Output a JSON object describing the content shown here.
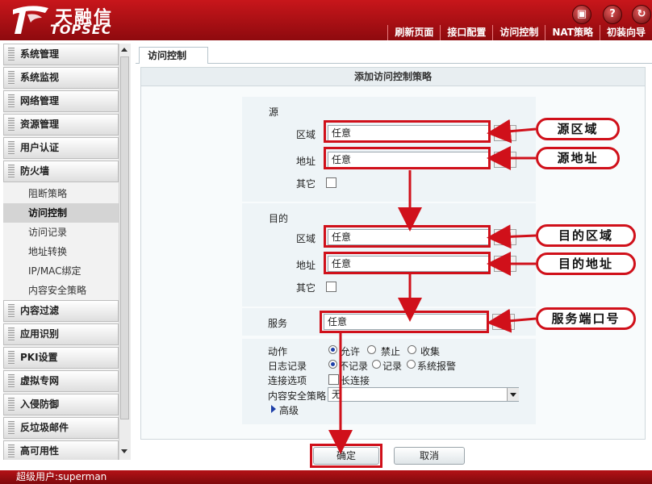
{
  "header": {
    "brand_cn": "天融信",
    "brand_en": "TOPSEC",
    "icons": [
      "save-icon",
      "help-icon",
      "logout-icon"
    ],
    "icon_glyphs": [
      "▣",
      "?",
      "↻"
    ],
    "nav": [
      "刷新页面",
      "接口配置",
      "访问控制",
      "NAT策略",
      "初装向导"
    ]
  },
  "sidebar": {
    "items_top": [
      "系统管理",
      "系统监视",
      "网络管理",
      "资源管理",
      "用户认证",
      "防火墙"
    ],
    "firewall_sub": [
      "阻断策略",
      "访问控制",
      "访问记录",
      "地址转换",
      "IP/MAC绑定",
      "内容安全策略"
    ],
    "active_sub": "访问控制",
    "items_bottom": [
      "内容过滤",
      "应用识别",
      "PKI设置",
      "虚拟专网",
      "入侵防御",
      "反垃圾邮件",
      "高可用性"
    ]
  },
  "tab": {
    "label": "访问控制"
  },
  "panel": {
    "title": "添加访问控制策略"
  },
  "source": {
    "heading": "源",
    "zone_label": "区域",
    "zone_value": "任意",
    "addr_label": "地址",
    "addr_value": "任意",
    "other_label": "其它"
  },
  "dest": {
    "heading": "目的",
    "zone_label": "区域",
    "zone_value": "任意",
    "addr_label": "地址",
    "addr_value": "任意",
    "other_label": "其它"
  },
  "service": {
    "label": "服务",
    "value": "任意"
  },
  "options": {
    "action_label": "动作",
    "action_options": [
      "允许",
      "禁止",
      "收集"
    ],
    "log_label": "日志记录",
    "log_options": [
      "不记录",
      "记录",
      "系统报警"
    ],
    "conn_label": "连接选项",
    "conn_option": "长连接",
    "content_label": "内容安全策略",
    "content_value": "无",
    "advanced": "高级"
  },
  "buttons": {
    "ok": "确定",
    "cancel": "取消"
  },
  "annotations": {
    "src_zone": "源区域",
    "src_addr": "源地址",
    "dst_zone": "目的区域",
    "dst_addr": "目的地址",
    "service_port": "服务端口号",
    "color": "#d0101a"
  },
  "footer": {
    "user": "超级用户:superman"
  }
}
